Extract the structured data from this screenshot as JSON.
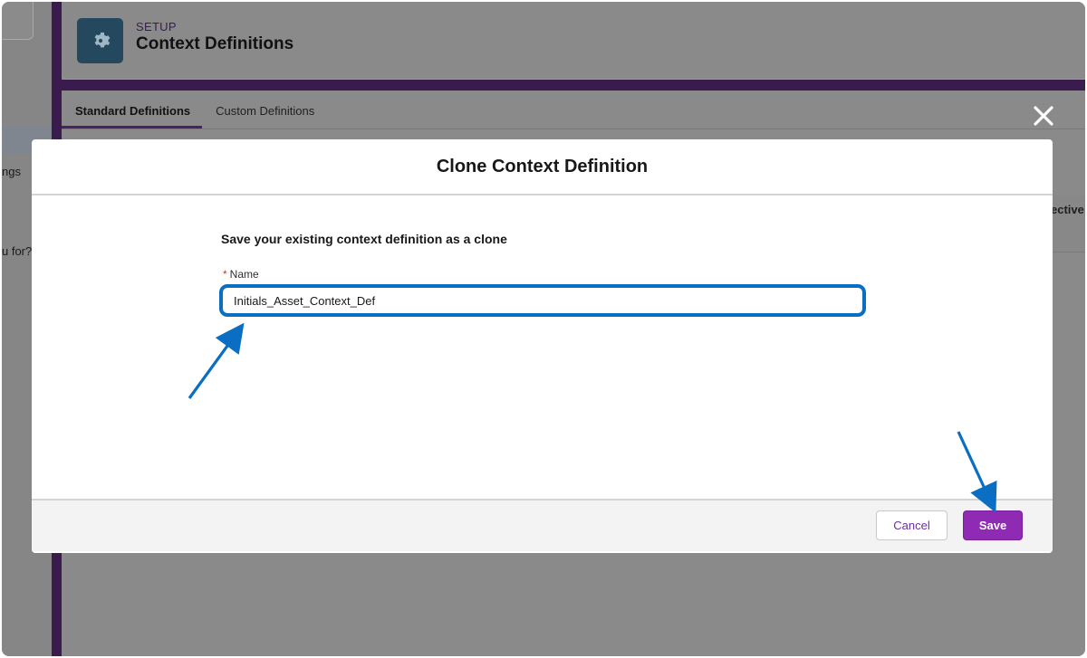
{
  "background": {
    "left_nav_snippets": [
      "ngs",
      "u for?"
    ],
    "setup_label": "SETUP",
    "page_title": "Context Definitions",
    "tabs": [
      {
        "label": "Standard Definitions",
        "active": true
      },
      {
        "label": "Custom Definitions",
        "active": false
      }
    ],
    "right_column_header_fragment": "ective"
  },
  "modal": {
    "title": "Clone Context Definition",
    "section_heading": "Save your existing context definition as a clone",
    "name_field": {
      "label": "Name",
      "required_marker": "*",
      "value": "Initials_Asset_Context_Def"
    },
    "footer": {
      "cancel_label": "Cancel",
      "save_label": "Save"
    }
  },
  "colors": {
    "overlay_gray": "#8b8b8b",
    "brand_purple": "#8e2ab3",
    "highlight_blue": "#0a6fc2",
    "app_icon_bg": "#24495e"
  },
  "icons": {
    "app_icon": "gear-icon",
    "close": "close-icon"
  }
}
